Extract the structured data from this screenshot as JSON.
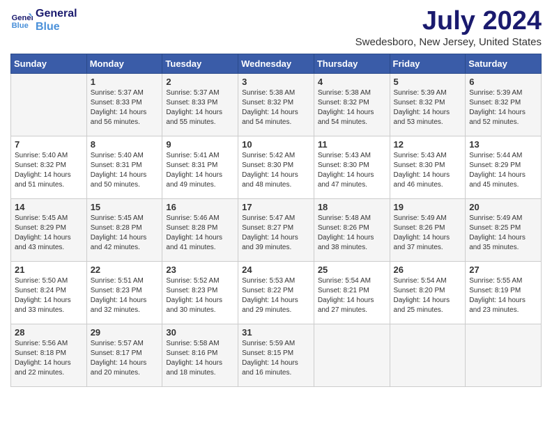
{
  "header": {
    "logo_line1": "General",
    "logo_line2": "Blue",
    "month_year": "July 2024",
    "location": "Swedesboro, New Jersey, United States"
  },
  "days_of_week": [
    "Sunday",
    "Monday",
    "Tuesday",
    "Wednesday",
    "Thursday",
    "Friday",
    "Saturday"
  ],
  "weeks": [
    [
      {
        "day": "",
        "info": ""
      },
      {
        "day": "1",
        "info": "Sunrise: 5:37 AM\nSunset: 8:33 PM\nDaylight: 14 hours\nand 56 minutes."
      },
      {
        "day": "2",
        "info": "Sunrise: 5:37 AM\nSunset: 8:33 PM\nDaylight: 14 hours\nand 55 minutes."
      },
      {
        "day": "3",
        "info": "Sunrise: 5:38 AM\nSunset: 8:32 PM\nDaylight: 14 hours\nand 54 minutes."
      },
      {
        "day": "4",
        "info": "Sunrise: 5:38 AM\nSunset: 8:32 PM\nDaylight: 14 hours\nand 54 minutes."
      },
      {
        "day": "5",
        "info": "Sunrise: 5:39 AM\nSunset: 8:32 PM\nDaylight: 14 hours\nand 53 minutes."
      },
      {
        "day": "6",
        "info": "Sunrise: 5:39 AM\nSunset: 8:32 PM\nDaylight: 14 hours\nand 52 minutes."
      }
    ],
    [
      {
        "day": "7",
        "info": "Sunrise: 5:40 AM\nSunset: 8:32 PM\nDaylight: 14 hours\nand 51 minutes."
      },
      {
        "day": "8",
        "info": "Sunrise: 5:40 AM\nSunset: 8:31 PM\nDaylight: 14 hours\nand 50 minutes."
      },
      {
        "day": "9",
        "info": "Sunrise: 5:41 AM\nSunset: 8:31 PM\nDaylight: 14 hours\nand 49 minutes."
      },
      {
        "day": "10",
        "info": "Sunrise: 5:42 AM\nSunset: 8:30 PM\nDaylight: 14 hours\nand 48 minutes."
      },
      {
        "day": "11",
        "info": "Sunrise: 5:43 AM\nSunset: 8:30 PM\nDaylight: 14 hours\nand 47 minutes."
      },
      {
        "day": "12",
        "info": "Sunrise: 5:43 AM\nSunset: 8:30 PM\nDaylight: 14 hours\nand 46 minutes."
      },
      {
        "day": "13",
        "info": "Sunrise: 5:44 AM\nSunset: 8:29 PM\nDaylight: 14 hours\nand 45 minutes."
      }
    ],
    [
      {
        "day": "14",
        "info": "Sunrise: 5:45 AM\nSunset: 8:29 PM\nDaylight: 14 hours\nand 43 minutes."
      },
      {
        "day": "15",
        "info": "Sunrise: 5:45 AM\nSunset: 8:28 PM\nDaylight: 14 hours\nand 42 minutes."
      },
      {
        "day": "16",
        "info": "Sunrise: 5:46 AM\nSunset: 8:28 PM\nDaylight: 14 hours\nand 41 minutes."
      },
      {
        "day": "17",
        "info": "Sunrise: 5:47 AM\nSunset: 8:27 PM\nDaylight: 14 hours\nand 39 minutes."
      },
      {
        "day": "18",
        "info": "Sunrise: 5:48 AM\nSunset: 8:26 PM\nDaylight: 14 hours\nand 38 minutes."
      },
      {
        "day": "19",
        "info": "Sunrise: 5:49 AM\nSunset: 8:26 PM\nDaylight: 14 hours\nand 37 minutes."
      },
      {
        "day": "20",
        "info": "Sunrise: 5:49 AM\nSunset: 8:25 PM\nDaylight: 14 hours\nand 35 minutes."
      }
    ],
    [
      {
        "day": "21",
        "info": "Sunrise: 5:50 AM\nSunset: 8:24 PM\nDaylight: 14 hours\nand 33 minutes."
      },
      {
        "day": "22",
        "info": "Sunrise: 5:51 AM\nSunset: 8:23 PM\nDaylight: 14 hours\nand 32 minutes."
      },
      {
        "day": "23",
        "info": "Sunrise: 5:52 AM\nSunset: 8:23 PM\nDaylight: 14 hours\nand 30 minutes."
      },
      {
        "day": "24",
        "info": "Sunrise: 5:53 AM\nSunset: 8:22 PM\nDaylight: 14 hours\nand 29 minutes."
      },
      {
        "day": "25",
        "info": "Sunrise: 5:54 AM\nSunset: 8:21 PM\nDaylight: 14 hours\nand 27 minutes."
      },
      {
        "day": "26",
        "info": "Sunrise: 5:54 AM\nSunset: 8:20 PM\nDaylight: 14 hours\nand 25 minutes."
      },
      {
        "day": "27",
        "info": "Sunrise: 5:55 AM\nSunset: 8:19 PM\nDaylight: 14 hours\nand 23 minutes."
      }
    ],
    [
      {
        "day": "28",
        "info": "Sunrise: 5:56 AM\nSunset: 8:18 PM\nDaylight: 14 hours\nand 22 minutes."
      },
      {
        "day": "29",
        "info": "Sunrise: 5:57 AM\nSunset: 8:17 PM\nDaylight: 14 hours\nand 20 minutes."
      },
      {
        "day": "30",
        "info": "Sunrise: 5:58 AM\nSunset: 8:16 PM\nDaylight: 14 hours\nand 18 minutes."
      },
      {
        "day": "31",
        "info": "Sunrise: 5:59 AM\nSunset: 8:15 PM\nDaylight: 14 hours\nand 16 minutes."
      },
      {
        "day": "",
        "info": ""
      },
      {
        "day": "",
        "info": ""
      },
      {
        "day": "",
        "info": ""
      }
    ]
  ]
}
